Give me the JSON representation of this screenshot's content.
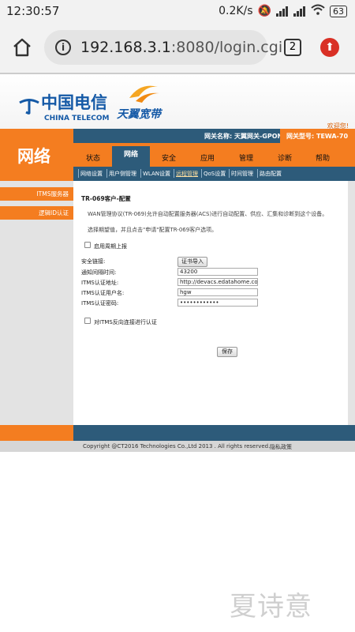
{
  "status_bar": {
    "time": "12:30:57",
    "network_speed": "0.2K/s",
    "battery": "63"
  },
  "browser": {
    "url_host": "192.168.3.1",
    "url_rest": ":8080/login.cgi",
    "tab_count": "2"
  },
  "header": {
    "ct_brand_cn": "中国电信",
    "ct_brand_en": "CHINA TELECOM",
    "tianyi_brand": "天翼宽带",
    "welcome": "欢迎您!",
    "gateway_name": "网关名称: 天翼网关-GPON",
    "gateway_model": "网关型号: TEWA-70",
    "section_title": "网络"
  },
  "nav": {
    "items": [
      "状态",
      "网络",
      "安全",
      "应用",
      "管理",
      "诊断",
      "帮助"
    ],
    "active": "网络"
  },
  "subnav": {
    "items": [
      "网络设置",
      "用户侧管理",
      "WLAN设置",
      "远程管理",
      "QoS设置",
      "时间管理",
      "路由配置"
    ],
    "active_index": 3
  },
  "leftmenu": {
    "items": [
      "ITMS服务器",
      "逻辑ID认证"
    ]
  },
  "form": {
    "heading": "TR-069客户-配置",
    "desc1": "WAN管理协议(TR-069)允许自动配置服务器(ACS)进行自动配置、供应、汇集和诊断到这个设备。",
    "desc2": "选择期望值，并且点击\"申请\"配置TR-069客户选项。",
    "periodic_inform_label": "启用周期上报",
    "security_link_label": "安全链接:",
    "cert_import_button": "证书导入",
    "inform_interval_label": "通知间隔时间:",
    "inform_interval_value": "43200",
    "acs_url_label": "ITMS认证地址:",
    "acs_url_value": "http://devacs.edatahome.com:9",
    "acs_user_label": "ITMS认证用户名:",
    "acs_user_value": "hgw",
    "acs_password_label": "ITMS认证密码:",
    "acs_password_value": "••••••••••••",
    "reverse_auth_label": "对ITMS反向连接进行认证",
    "save_button": "保存"
  },
  "footer": {
    "copyright": "Copyright @CT2016 Technologies Co.,Ltd 2013 . All rights reserved.",
    "privacy": "隐私政策"
  },
  "watermark": "夏诗意",
  "colors": {
    "orange": "#f47d20",
    "dark_blue": "#2d5b7a",
    "brand_blue": "#1459a6"
  }
}
